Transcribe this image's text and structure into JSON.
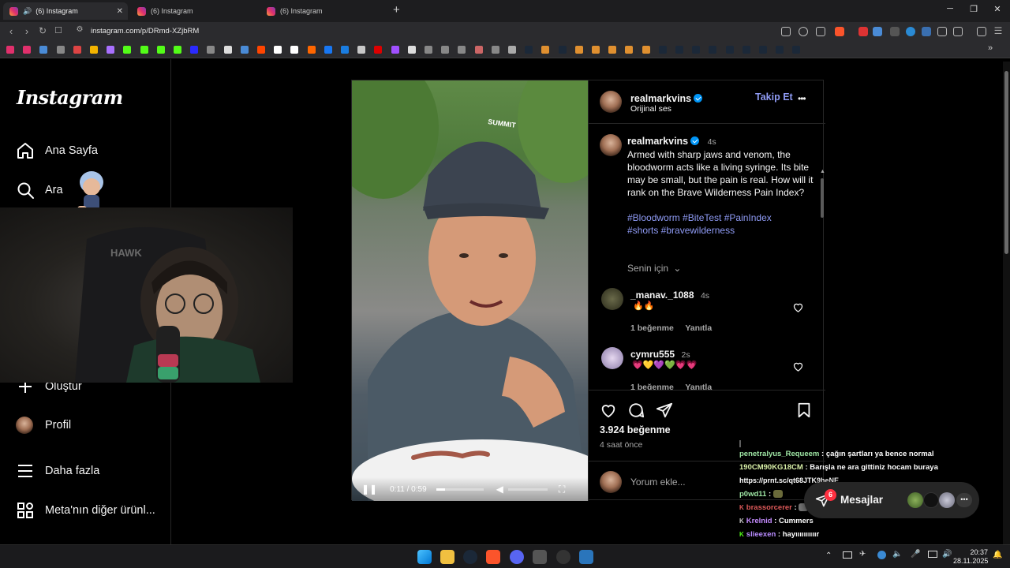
{
  "browser": {
    "tabs": [
      {
        "title": "(6) Instagram",
        "active": true
      },
      {
        "title": "(6) Instagram",
        "active": false
      },
      {
        "title": "(6) Instagram",
        "active": false
      }
    ],
    "new_tab": "+",
    "url": "instagram.com/p/DRmd-XZjbRM",
    "window_controls": {
      "minimize": "─",
      "restore": "❐",
      "close": "✕"
    }
  },
  "sidebar": {
    "logo": "Instagram",
    "items": [
      {
        "label": "Ana Sayfa",
        "icon": "home-icon"
      },
      {
        "label": "Ara",
        "icon": "search-icon"
      },
      {
        "label": "Oluştur",
        "icon": "plus-icon"
      },
      {
        "label": "Profil",
        "icon": "avatar-icon"
      },
      {
        "label": "Daha fazla",
        "icon": "menu-icon"
      },
      {
        "label": "Meta'nın diğer ürünl...",
        "icon": "apps-icon"
      }
    ]
  },
  "post": {
    "author": "realmarkvins",
    "audio": "Orijinal ses",
    "follow": "Takip Et",
    "more": "•••",
    "caption_time": "4s",
    "caption": "Armed with sharp jaws and venom, the bloodworm acts like a living syringe. Its bite may be small, but the pain is real. How will it rank on the Brave Wilderness Pain Index?",
    "hashtags_line1": "#Bloodworm #BiteTest #PainIndex",
    "hashtags_line2": "#shorts #bravewilderness",
    "for_you": "Senin için",
    "comments": [
      {
        "user": "_manav._1088",
        "time": "4s",
        "text": "🔥🔥",
        "likes": "1 beğenme",
        "reply": "Yanıtla"
      },
      {
        "user": "cymru555",
        "time": "2s",
        "text": "💗💛💜💚💗💗",
        "likes": "1 beğenme",
        "reply": "Yanıtla"
      }
    ],
    "like_count": "3.924 beğenme",
    "posted": "4 saat önce",
    "comment_placeholder": "Yorum ekle...",
    "video": {
      "time": "0:11 / 0:59",
      "progress": 0.19,
      "cap_text": "SUMMIT"
    }
  },
  "chat": [
    {
      "name": "penetralyus_Requeem",
      "color": "#9ee6a4",
      "msg": ": çağın şartları ya bence normal",
      "badge": ""
    },
    {
      "name": "190CM90KG18CM",
      "color": "#d9f0a8",
      "msg": ": Barışla ne ara gittiniz hocam buraya",
      "badge": ""
    },
    {
      "name": "",
      "color": "#ffffff",
      "msg": "https://prnt.sc/qt68JTK9heNE",
      "badge": ""
    },
    {
      "name": "p0wd11",
      "color": "#9ee6a4",
      "msg": ":",
      "badge": ""
    },
    {
      "name": "brassorcerer",
      "color": "#e05a5a",
      "msg": ":",
      "badge": "K"
    },
    {
      "name": "Krelnid",
      "color": "#c58cff",
      "msg": ": Cummers",
      "badge": "K"
    },
    {
      "name": "slieexen",
      "color": "#b98cff",
      "msg": ": hayıııııııııır",
      "badge": "K"
    }
  ],
  "messages": {
    "label": "Mesajlar",
    "badge": "6"
  },
  "taskbar": {
    "time": "20:37",
    "date": "28.11.2025"
  },
  "colors": {
    "accent": "#0095f6",
    "link": "#8f9bf5",
    "background": "#000000"
  }
}
